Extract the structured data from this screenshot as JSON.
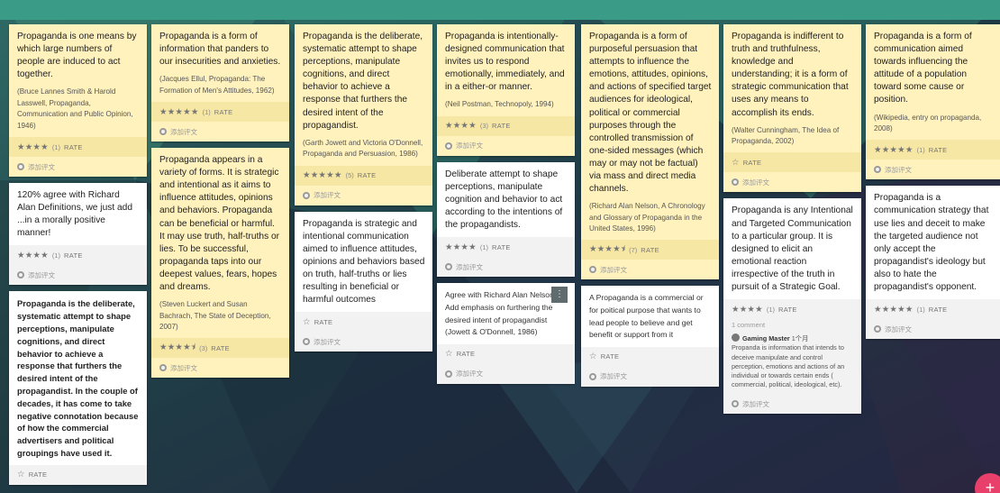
{
  "board": {
    "columns": [
      {
        "cards": [
          {
            "id": "c1",
            "tone": "y",
            "bold": false,
            "text": "Propaganda is one means by which large numbers of people are induced to act together.",
            "cite": "(Bruce Lannes Smith & Harold Lasswell, Propaganda, Communication and Public Opinion, 1946)",
            "stars": "★★★★",
            "rating": "(1)",
            "rate_label": "RATE",
            "comment_label": "添加评文"
          },
          {
            "id": "c2",
            "tone": "w",
            "bold": false,
            "text": "120% agree with Richard Alan Definitions, we just add ...in a morally positive manner!",
            "cite": "",
            "stars": "★★★★",
            "rating": "(1)",
            "rate_label": "RATE",
            "comment_label": "添加评文"
          },
          {
            "id": "c3",
            "tone": "w",
            "bold": true,
            "text": "Propaganda is the deliberate, systematic attempt to shape perceptions, manipulate cognitions, and direct behavior to achieve a response that furthers the desired intent of the propagandist. In the couple of decades, it has come to take negative connotation because of how the commercial advertisers and political groupings have used it.",
            "cite": "",
            "stars": "☆",
            "rating": "",
            "rate_label": "RATE",
            "comment_label": ""
          }
        ]
      },
      {
        "cards": [
          {
            "id": "c4",
            "tone": "y",
            "bold": false,
            "text": "Propaganda is a form of information that panders to our insecurities and anxieties.",
            "cite": "(Jacques Ellul, Propaganda: The Formation of Men's Attitudes, 1962)",
            "stars": "★★★★★",
            "rating": "(1)",
            "rate_label": "RATE",
            "comment_label": "添加评文"
          },
          {
            "id": "c5",
            "tone": "y",
            "bold": false,
            "text": "Propaganda appears in a variety of forms. It is strategic and intentional as it aims to influence attitudes, opinions and behaviors. Propaganda can be beneficial or harmful. It may use truth, half-truths or lies. To be successful, propaganda taps into our deepest values, fears, hopes and dreams.",
            "cite": "(Steven Luckert and Susan Bachrach, The State of Deception, 2007)",
            "stars": "★★★★⯨",
            "rating": "(3)",
            "rate_label": "RATE",
            "comment_label": "添加评文"
          }
        ]
      },
      {
        "cards": [
          {
            "id": "c6",
            "tone": "y",
            "bold": false,
            "text": "Propaganda is the deliberate, systematic attempt to shape perceptions, manipulate cognitions, and direct behavior to achieve a response that furthers the desired intent of the propagandist.",
            "cite": "(Garth Jowett and Victoria O'Donnell, Propaganda and Persuasion, 1986)",
            "stars": "★★★★★",
            "rating": "(5)",
            "rate_label": "RATE",
            "comment_label": "添加评文"
          },
          {
            "id": "c7",
            "tone": "w",
            "bold": false,
            "text": "Propaganda is strategic and intentional  communication aimed to influence attitudes, opinions and behaviors based on  truth, half-truths or lies resulting in beneficial or harmful outcomes",
            "cite": "",
            "stars": "☆",
            "rating": "",
            "rate_label": "RATE",
            "comment_label": "添加评文"
          }
        ]
      },
      {
        "cards": [
          {
            "id": "c8",
            "tone": "y",
            "bold": false,
            "text": "Propaganda is intentionally-designed communication that invites us to respond emotionally, immediately, and in a either-or manner.",
            "cite": "(Neil Postman, Technopoly, 1994)",
            "stars": "★★★★",
            "rating": "(3)",
            "rate_label": "RATE",
            "comment_label": "添加评文"
          },
          {
            "id": "c9",
            "tone": "w",
            "bold": false,
            "text": "Deliberate attempt to shape perceptions, manipulate cognition and behavior to act according to the intentions of the propagandists.",
            "cite": "",
            "stars": "★★★★",
            "rating": "(1)",
            "rate_label": "RATE",
            "comment_label": "添加评文"
          },
          {
            "id": "c10",
            "tone": "w",
            "bold": false,
            "small": true,
            "text": "Agree with Richard Alan Nelson. Add emphasis on furthering the desired intent of propagandist (Jowett & O'Donnell, 1986)",
            "cite": "",
            "stars": "☆",
            "rating": "",
            "rate_label": "RATE",
            "comment_label": "添加评文"
          }
        ]
      },
      {
        "cards": [
          {
            "id": "c11",
            "tone": "y",
            "bold": false,
            "text": "Propaganda is a form of purposeful persuasion that attempts to influence the emotions, attitudes, opinions, and actions of specified target audiences for ideological, political or commercial purposes through the controlled transmission of one-sided messages (which may or may not be factual) via mass and direct media channels.",
            "cite": "(Richard Alan Nelson, A Chronology and Glossary of Propaganda in the United States, 1996)",
            "stars": "★★★★⯨",
            "rating": "(7)",
            "rate_label": "RATE",
            "comment_label": "添加评文"
          },
          {
            "id": "c12",
            "tone": "w",
            "bold": false,
            "small": true,
            "text": "A Propaganda is a commercial or for poitical purpose that wants to lead people to believe and get benefit or support from it",
            "cite": "",
            "stars": "☆",
            "rating": "",
            "rate_label": "RATE",
            "comment_label": "添加评文"
          }
        ]
      },
      {
        "cards": [
          {
            "id": "c13",
            "tone": "y",
            "bold": false,
            "text": "Propaganda is indifferent to truth and truthfulness, knowledge and understanding; it is a form of strategic communication that uses any means to accomplish its ends.",
            "cite": "(Walter Cunningham, The Idea of Propaganda, 2002)",
            "stars": "☆",
            "rating": "",
            "rate_label": "RATE",
            "comment_label": "添加评文"
          },
          {
            "id": "c14",
            "tone": "w",
            "bold": false,
            "text": "Propaganda is any Intentional and Targeted Communication to a particular group. It is designed to elicit an emotional reaction irrespective of the truth in pursuit of a  Strategic Goal.",
            "cite": "",
            "stars": "★★★★",
            "rating": "(1)",
            "rate_label": "RATE",
            "comment_label": "添加评文",
            "comment_count": "1 comment",
            "comment_author": "Gaming Master",
            "comment_time": "1个月",
            "comment_text": "Propanda is information that intends to deceive manipulate and control perception, emotions and actions of an individual or towards certain ends ( commercial, political, ideological, etc)."
          }
        ]
      },
      {
        "cards": [
          {
            "id": "c15",
            "tone": "y",
            "bold": false,
            "text": "Propaganda is a form of communication aimed towards influencing the attitude of a population toward some cause or position.",
            "cite": "(Wikipedia, entry on propaganda, 2008)",
            "stars": "★★★★★",
            "rating": "(1)",
            "rate_label": "RATE",
            "comment_label": "添加评文"
          },
          {
            "id": "c16",
            "tone": "w",
            "bold": false,
            "text": "Propaganda is a communication strategy that use lies and deceit to make the targeted audience not only accept the propagandist's ideology but also to hate the propagandist's opponent.",
            "cite": "",
            "stars": "★★★★★",
            "rating": "(1)",
            "rate_label": "RATE",
            "comment_label": "添加评文"
          }
        ]
      }
    ]
  },
  "controls": {
    "card_menu_icon": "more-vert-icon",
    "add_fab_label": "+"
  },
  "colors": {
    "topbar": "#3a9b86",
    "card_yellow": "#fff2bd",
    "card_white": "#ffffff",
    "fab": "#e8406a"
  }
}
